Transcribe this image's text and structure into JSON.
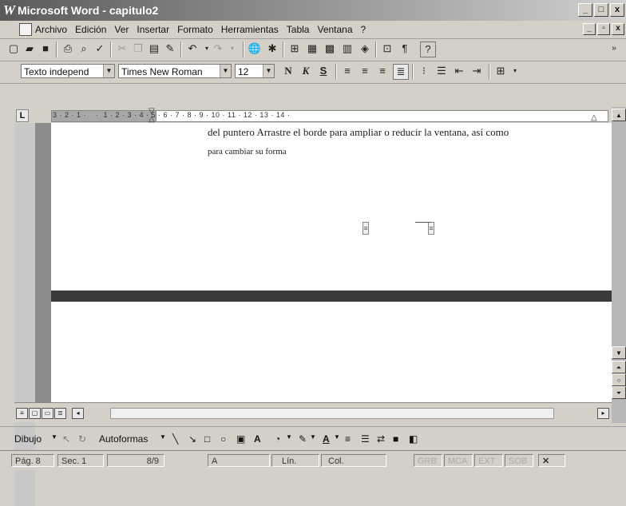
{
  "window": {
    "title": "Microsoft Word - capitulo2",
    "app_icon": "W",
    "controls": [
      "_",
      "□",
      "x"
    ]
  },
  "menu": {
    "items": [
      "Archivo",
      "Edición",
      "Ver",
      "Insertar",
      "Formato",
      "Herramientas",
      "Tabla",
      "Ventana",
      "?"
    ],
    "doc_controls": [
      "_",
      "▫",
      "x"
    ]
  },
  "standard_toolbar": {
    "undo_icon": "↶",
    "redo_icon": "↷",
    "help_icon": "?",
    "show_marks_icon": "¶"
  },
  "format_toolbar": {
    "style": "Texto independ",
    "font": "Times New Roman",
    "size": "12",
    "bold": "N",
    "italic": "K",
    "underline": "S"
  },
  "ruler": {
    "tab_selector": "L",
    "ticks": "3 · 2 · 1 ·    ·  1 · 2 · 3 · 4 · 5 · 6 · 7 · 8 · 9 · 10 · 11 · 12 · 13 · 14 ·"
  },
  "document": {
    "line1": "del puntero   Arrastre el borde para ampliar o reducir la ventana, así como",
    "line2": "para cambiar su forma"
  },
  "drawing_toolbar": {
    "draw_label": "Dibujo",
    "autoshapes_label": "Autoformas"
  },
  "status_bar": {
    "page": "Pág. 8",
    "section": "Sec. 1",
    "pages": "8/9",
    "at": "A",
    "line": "Lín.",
    "col": "Col.",
    "rec": "GRB",
    "trk": "MCA",
    "ext": "EXT",
    "ovr": "SOB"
  }
}
